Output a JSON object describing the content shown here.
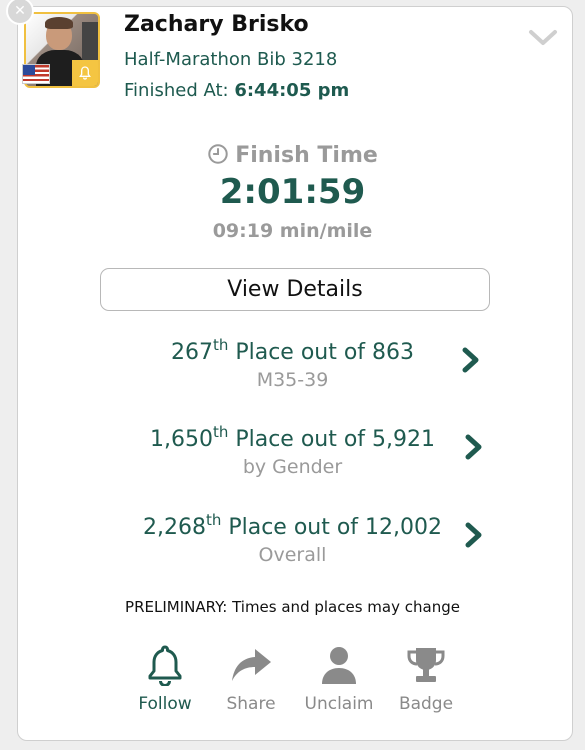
{
  "runner": {
    "name": "Zachary Brisko",
    "bib_line": "Half-Marathon Bib 3218",
    "finished_label": "Finished At:",
    "finished_time": "6:44:05 pm"
  },
  "finish": {
    "label": "Finish Time",
    "time": "2:01:59",
    "pace": "09:19 min/mile"
  },
  "view_details_label": "View Details",
  "places": [
    {
      "rank": "267",
      "suffix": "th",
      "text": " Place out of 863",
      "sub": "M35-39"
    },
    {
      "rank": "1,650",
      "suffix": "th",
      "text": " Place out of 5,921",
      "sub": "by Gender"
    },
    {
      "rank": "2,268",
      "suffix": "th",
      "text": " Place out of 12,002",
      "sub": "Overall"
    }
  ],
  "preliminary_note": "PRELIMINARY: Times and places may change",
  "actions": [
    {
      "label": "Follow",
      "icon": "bell-icon"
    },
    {
      "label": "Share",
      "icon": "share-arrow-icon"
    },
    {
      "label": "Unclaim",
      "icon": "person-icon"
    },
    {
      "label": "Badge",
      "icon": "trophy-icon"
    }
  ],
  "colors": {
    "accent": "#1f5a4f",
    "muted": "#9a9a9a",
    "badge_yellow": "#f4c542"
  }
}
